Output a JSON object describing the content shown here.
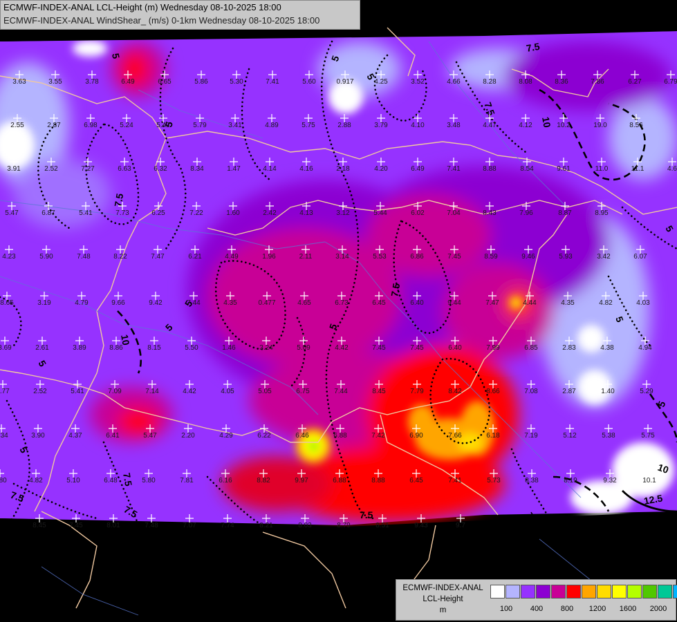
{
  "header": {
    "line1": "ECMWF-INDEX-ANAL LCL-Height (m) Wednesday 08-10-2025 18:00",
    "line2": "ECMWF-INDEX-ANAL WindShear_ (m/s) 0-1km Wednesday 08-10-2025 18:00"
  },
  "legend": {
    "line1": "ECMWF-INDEX-ANAL",
    "line2": "LCL-Height",
    "line3": "m",
    "colors": [
      "#ffffff",
      "#b4b4ff",
      "#9632ff",
      "#8c00d2",
      "#c80096",
      "#ff0000",
      "#ffa500",
      "#ffdc00",
      "#ffff00",
      "#b4ff00",
      "#50c800",
      "#00c896",
      "#00b4ff"
    ],
    "ticks": [
      {
        "label": "100",
        "idx": 1
      },
      {
        "label": "400",
        "idx": 3
      },
      {
        "label": "800",
        "idx": 5
      },
      {
        "label": "1200",
        "idx": 7
      },
      {
        "label": "1600",
        "idx": 9
      },
      {
        "label": "2000",
        "idx": 11
      }
    ]
  },
  "values": [
    "3.63",
    "3.55",
    "3.78",
    "6.49",
    "6.65",
    "5.86",
    "5.30",
    "7.41",
    "5.60",
    "0.917",
    "4.25",
    "3.52",
    "4.66",
    "8.28",
    "8.08",
    "8.36",
    "7.86",
    "6.27",
    "6.79",
    "2.55",
    "2.87",
    "6.98",
    "5.24",
    "5.42",
    "5.79",
    "3.41",
    "4.89",
    "5.75",
    "2.88",
    "3.79",
    "4.10",
    "3.48",
    "4.47",
    "4.12",
    "10.2",
    "19.0",
    "8.56",
    "3.91",
    "2.52",
    "7.27",
    "6.63",
    "6.32",
    "8.34",
    "1.47",
    "4.14",
    "4.16",
    "2.18",
    "4.20",
    "6.49",
    "7.41",
    "8.88",
    "8.54",
    "9.61",
    "11.0",
    "11.1",
    "4.6",
    "5.47",
    "6.87",
    "5.41",
    "7.73",
    "6.25",
    "7.22",
    "1.60",
    "2.42",
    "4.13",
    "3.12",
    "5.44",
    "6.02",
    "7.04",
    "8.43",
    "7.96",
    "8.87",
    "8.95",
    "4.23",
    "5.90",
    "7.48",
    "8.22",
    "7.47",
    "6.21",
    "4.49",
    "1.96",
    "2.11",
    "3.14",
    "5.53",
    "6.86",
    "7.45",
    "8.59",
    "9.46",
    "5.93",
    "3.42",
    "6.07",
    "8.65",
    "3.19",
    "4.79",
    "9.66",
    "9.42",
    "7.44",
    "4.35",
    "0.477",
    "4.65",
    "6.73",
    "6.45",
    "6.40",
    "9.44",
    "7.47",
    "4.44",
    "4.35",
    "4.82",
    "4.03",
    "3.69",
    "2.61",
    "3.89",
    "8.86",
    "8.15",
    "5.50",
    "1.46",
    "3.24",
    "5.09",
    "4.42",
    "7.45",
    "7.45",
    "6.40",
    "7.99",
    "6.85",
    "2.83",
    "4.38",
    "4.94",
    "2.77",
    "2.52",
    "5.41",
    "7.09",
    "7.14",
    "4.42",
    "4.05",
    "5.05",
    "6.75",
    "7.44",
    "8.45",
    "7.79",
    "8.42",
    "8.66",
    "7.08",
    "2.87",
    "1.40",
    "5.29",
    "3.34",
    "3.90",
    "4.37",
    "6.41",
    "5.47",
    "2.20",
    "4.29",
    "6.22",
    "6.46",
    "6.88",
    "7.42",
    "6.90",
    "7.66",
    "6.18",
    "7.19",
    "5.12",
    "5.38",
    "5.75",
    "1.80",
    "4.82",
    "5.10",
    "6.48",
    "5.80",
    "7.81",
    "6.16",
    "8.82",
    "9.97",
    "6.88",
    "8.88",
    "6.45",
    "7.41",
    "5.73",
    "8.38",
    "8.19",
    "9.32",
    "10.1",
    "8.45",
    "7.45",
    "8.01",
    "7.48",
    "7.07",
    "7.74",
    "8.21",
    "8.03",
    "8.79",
    "8.51",
    "9.43",
    "9.7"
  ],
  "contour_labels": [
    "5",
    "7.5",
    "10",
    "12.5"
  ]
}
